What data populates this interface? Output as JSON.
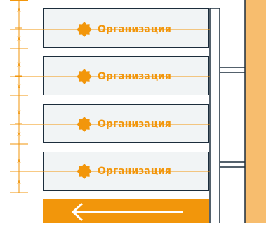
{
  "colors": {
    "accent": "#f2960b",
    "accent_light": "#f7bd6e",
    "card_fill": "#f1f4f5",
    "outline": "#1c2d3c"
  },
  "cards": [
    {
      "label": "Организация",
      "icon": "gear-icon"
    },
    {
      "label": "Организация",
      "icon": "gear-icon"
    },
    {
      "label": "Организация",
      "icon": "gear-icon"
    },
    {
      "label": "Организация",
      "icon": "gear-icon"
    }
  ],
  "dimension_marks": [
    "x",
    "x",
    "x",
    "x",
    "x",
    "x",
    "x",
    "x"
  ],
  "back_button": {
    "icon": "arrow-left-icon"
  }
}
